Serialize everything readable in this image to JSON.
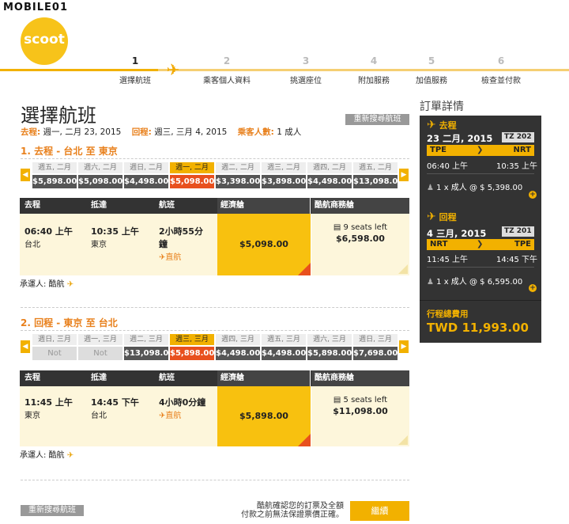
{
  "watermark": "MOBILE01",
  "brand": {
    "logo_text": "scoot",
    "accent": "#f2b100",
    "accent_orange": "#e8801c",
    "selected_red": "#e8501e"
  },
  "steps": [
    {
      "num": "1",
      "label": "選擇航班"
    },
    {
      "num": "2",
      "label": "乘客個人資料"
    },
    {
      "num": "3",
      "label": "挑選座位"
    },
    {
      "num": "4",
      "label": "附加服務"
    },
    {
      "num": "5",
      "label": "加值服務"
    },
    {
      "num": "6",
      "label": "檢查並付款"
    }
  ],
  "page": {
    "title": "選擇航班",
    "research_label": "重新搜尋航班",
    "summary": {
      "depart_label": "去程:",
      "depart_value": "週一, 二月 23, 2015",
      "return_label": "回程:",
      "return_value": "週三, 三月 4, 2015",
      "pax_label": "乘客人數:",
      "pax_value": "1 成人"
    }
  },
  "outbound": {
    "heading": "1. 去程 - 台北 至 東京",
    "dates": [
      {
        "day": "週五, 二月",
        "price": "$5,898.00"
      },
      {
        "day": "週六, 二月",
        "price": "$5,098.00"
      },
      {
        "day": "週日, 二月",
        "price": "$4,498.00"
      },
      {
        "day": "週一, 二月",
        "price": "$5,098.00"
      },
      {
        "day": "週二, 二月",
        "price": "$3,398.00"
      },
      {
        "day": "週三, 二月",
        "price": "$3,898.00"
      },
      {
        "day": "週四, 二月",
        "price": "$4,498.00"
      },
      {
        "day": "週五, 二月",
        "price": "$13,098.0"
      }
    ],
    "headers": {
      "depart": "去程",
      "arrive": "抵達",
      "duration": "航班",
      "economy": "經濟艙",
      "business": "酷航商務艙"
    },
    "depart_time": "06:40 上午",
    "depart_city": "台北",
    "arrive_time": "10:35 上午",
    "arrive_city": "東京",
    "duration": "2小時55分鐘",
    "direct": "直航",
    "economy_price": "$5,098.00",
    "business_seats": "9 seats left",
    "business_price": "$6,598.00",
    "carrier": "承運人: 酷航"
  },
  "inbound": {
    "heading": "2. 回程 - 東京 至 台北",
    "dates": [
      {
        "day": "週日, 三月",
        "price": "Not"
      },
      {
        "day": "週一, 三月",
        "price": "Not"
      },
      {
        "day": "週二, 三月",
        "price": "$13,098.0"
      },
      {
        "day": "週三, 三月",
        "price": "$5,898.00"
      },
      {
        "day": "週四, 三月",
        "price": "$4,498.00"
      },
      {
        "day": "週五, 三月",
        "price": "$4,498.00"
      },
      {
        "day": "週六, 三月",
        "price": "$5,898.00"
      },
      {
        "day": "週日, 三月",
        "price": "$7,698.00"
      }
    ],
    "headers": {
      "depart": "去程",
      "arrive": "抵達",
      "duration": "航班",
      "economy": "經濟艙",
      "business": "酷航商務艙"
    },
    "depart_time": "11:45 上午",
    "depart_city": "東京",
    "arrive_time": "14:45 下午",
    "arrive_city": "台北",
    "duration": "4小時0分鐘",
    "direct": "直航",
    "economy_price": "$5,898.00",
    "business_seats": "5 seats left",
    "business_price": "$11,098.00",
    "carrier": "承運人: 酷航"
  },
  "order": {
    "title": "訂單詳情",
    "out": {
      "label": "去程",
      "date": "23 二月, 2015",
      "flight": "TZ 202",
      "from": "TPE",
      "to": "NRT",
      "dep": "06:40 上午",
      "arr": "10:35 上午",
      "pax": "1 x 成人 @ $ 5,398.00"
    },
    "ret": {
      "label": "回程",
      "date": "4 三月, 2015",
      "flight": "TZ 201",
      "from": "NRT",
      "to": "TPE",
      "dep": "11:45 上午",
      "arr": "14:45 下午",
      "pax": "1 x 成人 @ $ 6,595.00"
    },
    "total_label": "行程總費用",
    "total": "TWD 11,993.00"
  },
  "footer": {
    "research_label": "重新搜尋航班",
    "note_line1": "酷航確認您的訂票及全額",
    "note_line2": "付款之前無法保證票價正確。",
    "continue_label": "繼續"
  }
}
